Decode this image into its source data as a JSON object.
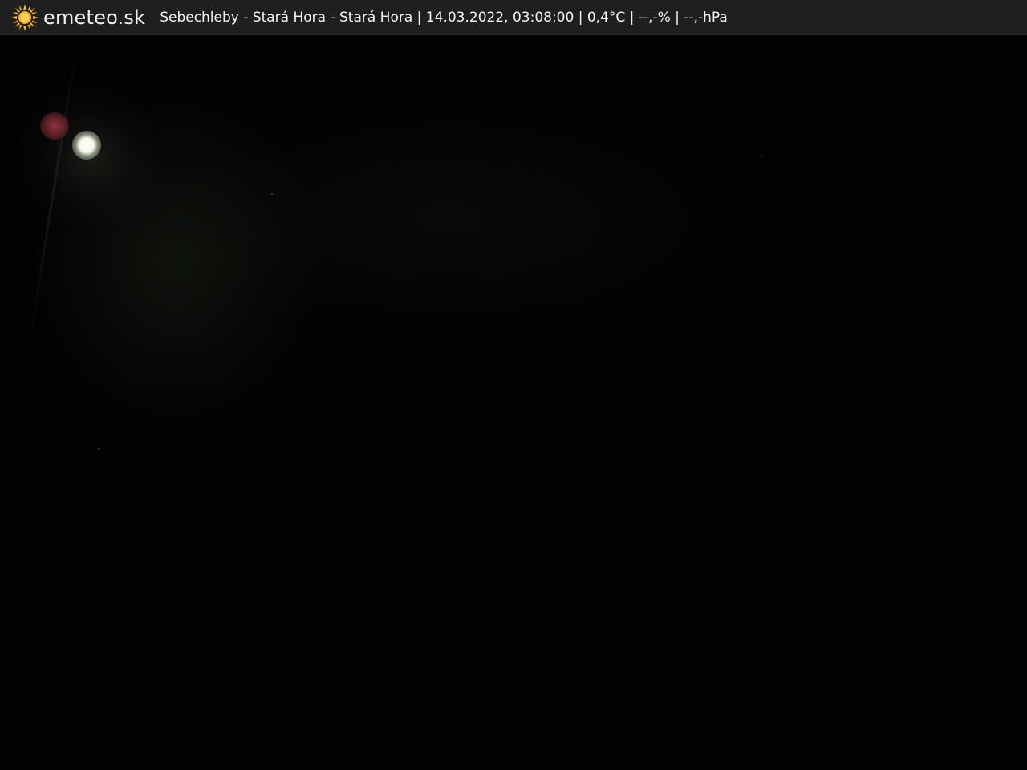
{
  "header": {
    "brand": "emeteo.sk",
    "caption": "Sebechleby - Stará Hora - Stará Hora | 14.03.2022, 03:08:00 | 0,4°C | --,-% | --,-hPa",
    "logo_icon": "sun-icon",
    "background_color": "#1f1f1f",
    "text_color": "#f5f5f5",
    "sun_color": "#f6b21b"
  },
  "image": {
    "scene": "webcam-night-view"
  }
}
